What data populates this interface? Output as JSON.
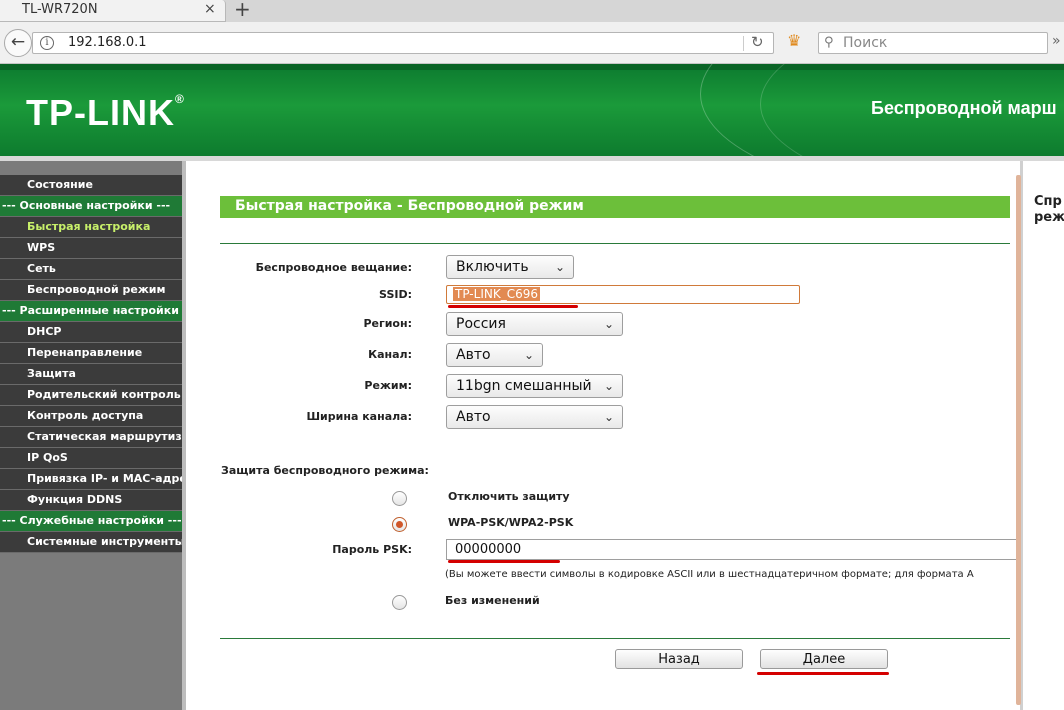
{
  "browser": {
    "tab_title": "TL-WR720N",
    "tab_close": "×",
    "new_tab": "+",
    "url": "192.168.0.1",
    "search_placeholder": "Поиск"
  },
  "header": {
    "logo": "TP-LINK",
    "logo_mark": "®",
    "title": "Беспроводной марш"
  },
  "sidebar": {
    "items": [
      {
        "label": "Состояние",
        "type": "item"
      },
      {
        "label": "--- Основные настройки ---",
        "type": "section"
      },
      {
        "label": "Быстрая настройка",
        "type": "item",
        "active": true
      },
      {
        "label": "WPS",
        "type": "item"
      },
      {
        "label": "Сеть",
        "type": "item"
      },
      {
        "label": "Беспроводной режим",
        "type": "item"
      },
      {
        "label": "--- Расширенные настройки ---",
        "type": "section"
      },
      {
        "label": "DHCP",
        "type": "item"
      },
      {
        "label": "Перенаправление",
        "type": "item"
      },
      {
        "label": "Защита",
        "type": "item"
      },
      {
        "label": "Родительский контроль",
        "type": "item"
      },
      {
        "label": "Контроль доступа",
        "type": "item"
      },
      {
        "label": "Статическая маршрутизац",
        "type": "item"
      },
      {
        "label": "IP QoS",
        "type": "item"
      },
      {
        "label": "Привязка IP- и MAC-адрес",
        "type": "item"
      },
      {
        "label": "Функция DDNS",
        "type": "item"
      },
      {
        "label": "--- Служебные настройки ---",
        "type": "section"
      },
      {
        "label": "Системные инструменты",
        "type": "item"
      }
    ]
  },
  "main": {
    "title": "Быстрая настройка - Беспроводной режим",
    "fields": {
      "broadcast_label": "Беспроводное вещание:",
      "broadcast_value": "Включить",
      "ssid_label": "SSID:",
      "ssid_value": "TP-LINK_C696",
      "region_label": "Регион:",
      "region_value": "Россия",
      "channel_label": "Канал:",
      "channel_value": "Авто",
      "mode_label": "Режим:",
      "mode_value": "11bgn смешанный",
      "width_label": "Ширина канала:",
      "width_value": "Авто"
    },
    "security": {
      "label": "Защита беспроводного режима:",
      "option_disable": "Отключить защиту",
      "option_wpa": "WPA-PSK/WPA2-PSK",
      "psk_label": "Пароль PSK:",
      "psk_value": "00000000",
      "note": "(Вы можете ввести символы в кодировке ASCII или в шестнадцатеричном формате; для формата A",
      "option_nochange": "Без изменений",
      "selected": "WPA-PSK/WPA2-PSK"
    },
    "buttons": {
      "back": "Назад",
      "next": "Далее"
    }
  },
  "help": {
    "title_line1": "Спр",
    "title_line2": "реж"
  },
  "colors": {
    "brand_green": "#1b9a3a",
    "title_bar": "#6cbf3a",
    "annotation_red": "#d40000"
  }
}
